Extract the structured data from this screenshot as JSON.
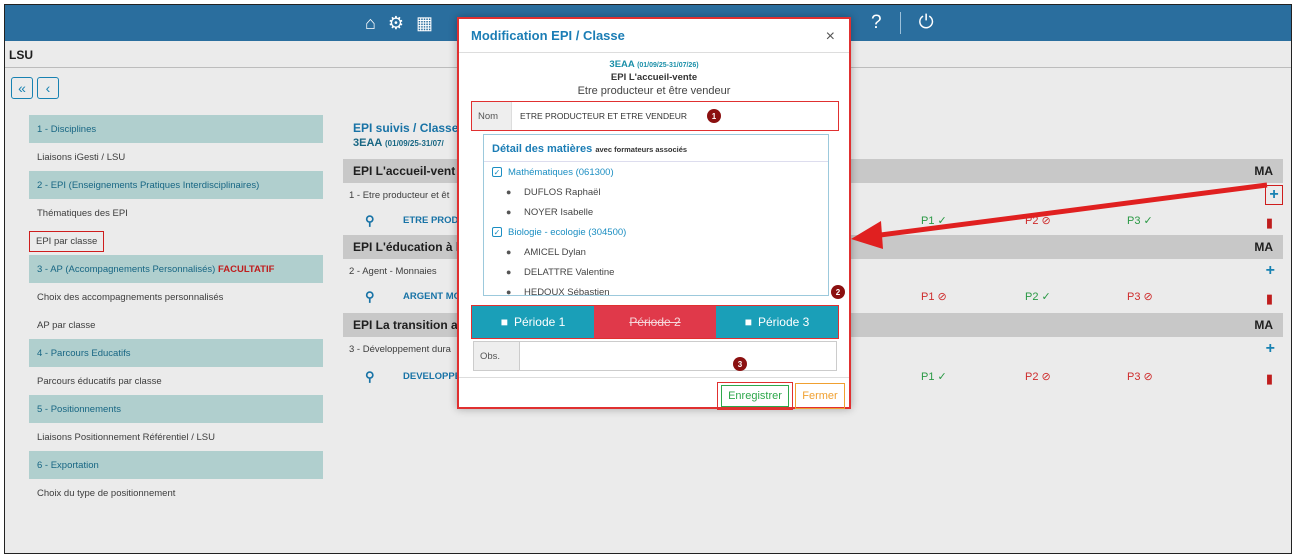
{
  "app": {
    "section": "LSU"
  },
  "nav": {
    "collapse_label": "«",
    "back_label": "‹"
  },
  "topbar": {
    "help_label": "?"
  },
  "sidebar": {
    "items": [
      {
        "label": "1 - Disciplines",
        "type": "head"
      },
      {
        "label": "Liaisons iGesti / LSU",
        "type": "item"
      },
      {
        "label": "2 - EPI (Enseignements Pratiques Interdisciplinaires)",
        "type": "head"
      },
      {
        "label": "Thématiques des EPI",
        "type": "item"
      },
      {
        "label": "EPI par classe",
        "type": "item",
        "selected": true
      },
      {
        "label": "3 - AP (Accompagnements Personnalisés)",
        "extra": "FACULTATIF",
        "type": "head"
      },
      {
        "label": "Choix des accompagnements personnalisés",
        "type": "item"
      },
      {
        "label": "AP par classe",
        "type": "item"
      },
      {
        "label": "4 - Parcours Educatifs",
        "type": "head"
      },
      {
        "label": "Parcours éducatifs par classe",
        "type": "item"
      },
      {
        "label": "5 - Positionnements",
        "type": "head"
      },
      {
        "label": "Liaisons Positionnement Référentiel / LSU",
        "type": "item"
      },
      {
        "label": "6 - Exportation",
        "type": "head"
      },
      {
        "label": "Choix du type de positionnement",
        "type": "item"
      }
    ]
  },
  "main": {
    "title": "EPI suivis / Classe",
    "subtitle_class": "3EAA",
    "subtitle_dates": "(01/09/25-31/07/",
    "sections": [
      {
        "title": "EPI L'accueil-vent",
        "ma": "MA",
        "line": "1 - Etre producteur et êt",
        "row": "ETRE PROD",
        "p1": "P1",
        "p1_status": "ok",
        "p2": "P2",
        "p2_status": "no",
        "p3": "P3",
        "p3_status": "ok"
      },
      {
        "title": "EPI L'éducation à l",
        "ma": "MA",
        "line": "2 - Agent - Monnaies",
        "row": "ARGENT MC",
        "p1": "P1",
        "p1_status": "no",
        "p2": "P2",
        "p2_status": "ok",
        "p3": "P3",
        "p3_status": "no"
      },
      {
        "title": "EPI La transition a",
        "ma": "MA",
        "line": "3 - Développement dura",
        "row": "DEVELOPPE",
        "p1": "P1",
        "p1_status": "ok",
        "p2": "P2",
        "p2_status": "no",
        "p3": "P3",
        "p3_status": "no"
      }
    ]
  },
  "modal": {
    "title": "Modification EPI / Classe",
    "close": "×",
    "class_code": "3EAA",
    "class_dates": "(01/09/25-31/07/26)",
    "epi_name": "EPI L'accueil-vente",
    "epi_sub": "Etre producteur et être vendeur",
    "nom_label": "Nom",
    "nom_value": "ETRE PRODUCTEUR ET ETRE VENDEUR",
    "details_title": "Détail des matières",
    "details_note": "avec formateurs associés",
    "subjects": [
      {
        "name": "Mathématiques (061300)",
        "teachers": [
          "DUFLOS Raphaël",
          "NOYER Isabelle"
        ]
      },
      {
        "name": "Biologie - ecologie (304500)",
        "teachers": [
          "AMICEL Dylan",
          "DELATTRE Valentine",
          "HEDOUX Sébastien"
        ]
      }
    ],
    "periods": [
      {
        "label": "Période 1",
        "state": "locked"
      },
      {
        "label": "Période 2",
        "state": "disabled"
      },
      {
        "label": "Période 3",
        "state": "locked"
      }
    ],
    "obs_label": "Obs.",
    "save_label": "Enregistrer",
    "close_label": "Fermer",
    "badges": [
      "1",
      "2",
      "3"
    ]
  },
  "colors": {
    "accent": "#1b7db5",
    "highlight": "#e03030",
    "ok": "#2ea74b"
  }
}
